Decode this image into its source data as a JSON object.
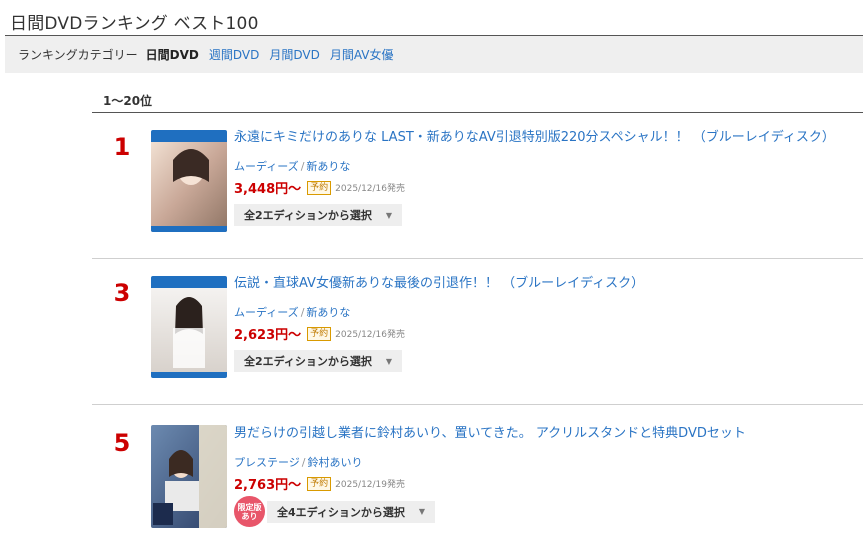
{
  "page": {
    "title": "日間DVDランキング ベスト100"
  },
  "category": {
    "label": "ランキングカテゴリー",
    "current": "日間DVD",
    "links": [
      "週間DVD",
      "月間DVD",
      "月間AV女優"
    ]
  },
  "range": "1〜20位",
  "items": [
    {
      "rank": "1",
      "title": "永遠にキミだけのありな LAST・新ありなAV引退特別版220分スペシャル！！ （ブルーレイディスク）",
      "maker": "ムーディーズ",
      "actress": "新ありな",
      "price": "3,448円〜",
      "badge": "予約",
      "release": "2025/12/16発売",
      "select": "全2エディションから選択",
      "limited": ""
    },
    {
      "rank": "3",
      "title": "伝説・直球AV女優新ありな最後の引退作！！ （ブルーレイディスク）",
      "maker": "ムーディーズ",
      "actress": "新ありな",
      "price": "2,623円〜",
      "badge": "予約",
      "release": "2025/12/16発売",
      "select": "全2エディションから選択",
      "limited": ""
    },
    {
      "rank": "5",
      "title": "男だらけの引越し業者に鈴村あいり、置いてきた。 アクリルスタンドと特典DVDセット",
      "maker": "プレステージ",
      "actress": "鈴村あいり",
      "price": "2,763円〜",
      "badge": "予約",
      "release": "2025/12/19発売",
      "select": "全4エディションから選択",
      "limited": "限定版あり"
    }
  ],
  "colors": {
    "accent_link": "#2a74c4",
    "rank_red": "#cc0000",
    "price_red": "#cc0000",
    "bluray_blue": "#1f6fc0",
    "limited_pink": "#e8566a"
  }
}
